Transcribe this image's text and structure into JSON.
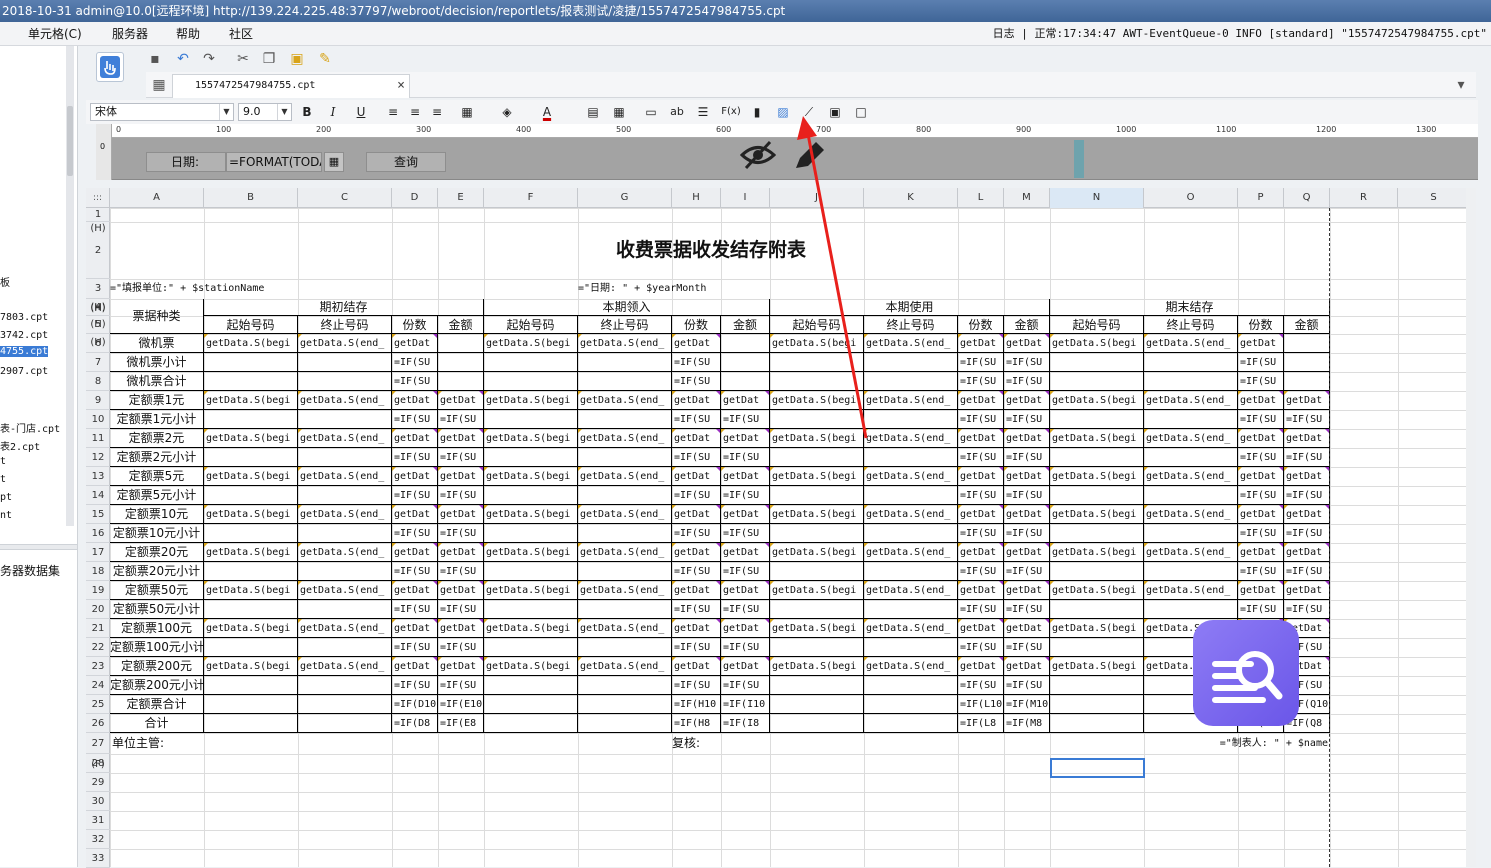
{
  "titlebar": {
    "text": "2018-10-31 admin@10.0[远程环境]   http://139.224.225.48:37797/webroot/decision/reportlets/报表测试/凌捷/1557472547984755.cpt"
  },
  "menu": {
    "items": [
      {
        "label": "单元格(C)"
      },
      {
        "label": "服务器"
      },
      {
        "label": "帮助"
      },
      {
        "label": "社区"
      }
    ]
  },
  "log": {
    "text": "日志 | 正常:17:34:47 AWT-EventQueue-0 INFO [standard] \"1557472547984755.cpt\""
  },
  "left_panel": {
    "items": [
      "板",
      "7803.cpt",
      "3742.cpt",
      "4755.cpt",
      "2907.cpt",
      "表-门店.cpt",
      "表2.cpt",
      "t",
      "pt",
      "t",
      "nt"
    ],
    "selected_index": 3,
    "dataset_label": "务器数据集"
  },
  "tab": {
    "label": "1557472547984755.cpt",
    "close": "×"
  },
  "format": {
    "font": "宋体",
    "size": "9.0",
    "bold": "B",
    "italic": "I",
    "underline": "U",
    "text_btn": "ab",
    "formula_btn": "F(x)"
  },
  "ruler": {
    "labels": [
      "0",
      "100",
      "200",
      "300",
      "400",
      "500",
      "600",
      "700",
      "800",
      "900",
      "1000",
      "1100",
      "1200",
      "1300"
    ]
  },
  "param": {
    "label": "日期:",
    "input_value": "=FORMAT(TODA",
    "query_button": "查询"
  },
  "columns": [
    "A",
    "B",
    "C",
    "D",
    "E",
    "F",
    "G",
    "H",
    "I",
    "J",
    "K",
    "L",
    "M",
    "N",
    "O",
    "P",
    "Q",
    "R",
    "S"
  ],
  "rows": [
    "1 (H)",
    "2 (H)",
    "3 (H)",
    "4 (H)",
    "5 (H)",
    "6",
    "7",
    "8",
    "9",
    "10",
    "11",
    "12",
    "13",
    "14",
    "15",
    "16",
    "17",
    "18",
    "19",
    "20",
    "21",
    "22",
    "23",
    "24",
    "25",
    "26",
    "27 (F)",
    "28",
    "29",
    "30",
    "31",
    "32",
    "33"
  ],
  "report": {
    "title": "收费票据收发结存附表",
    "station_formula": "=\"填报单位:\" + $stationName",
    "date_formula": "=\"日期: \" + $yearMonth",
    "group_headers": [
      "期初结存",
      "本期领入",
      "本期使用",
      "期末结存"
    ],
    "type_header": "票据种类",
    "sub_headers": [
      "起始号码",
      "终止号码",
      "份数",
      "金额"
    ],
    "row_labels": [
      "微机票",
      "微机票小计",
      "微机票合计",
      "定额票1元",
      "定额票1元小计",
      "定额票2元",
      "定额票2元小计",
      "定额票5元",
      "定额票5元小计",
      "定额票10元",
      "定额票10元小计",
      "定额票20元",
      "定额票20元小计",
      "定额票50元",
      "定额票50元小计",
      "定额票100元",
      "定额票100元小计",
      "定额票200元",
      "定额票200元小计",
      "定额票合计",
      "合计"
    ],
    "cells": {
      "begin": "getData.S(begi",
      "end": "getData.S(end_",
      "getdat": "getDat",
      "sum": "=IF(SU",
      "r25": [
        "=IF(D10",
        "=IF(E10",
        "=IF(H10",
        "=IF(I10",
        "=IF(L10",
        "=IF(M10",
        "=IF(P",
        "=IF(Q10"
      ],
      "r26": [
        "=IF(D8",
        "=IF(E8",
        "=IF(H8",
        "=IF(I8",
        "=IF(L8",
        "=IF(M8",
        "=IF(P8",
        "=IF(Q8"
      ]
    },
    "footer_left": "单位主管:",
    "footer_mid": "复核:",
    "footer_right": "=\"制表人: \" + $name"
  },
  "colors": {
    "title_blue": "#4a70a4",
    "selection": "#3a7bd5",
    "param_bg": "#a3a3a3",
    "arrow": "#e8201c",
    "logo": "#7b68f0"
  }
}
